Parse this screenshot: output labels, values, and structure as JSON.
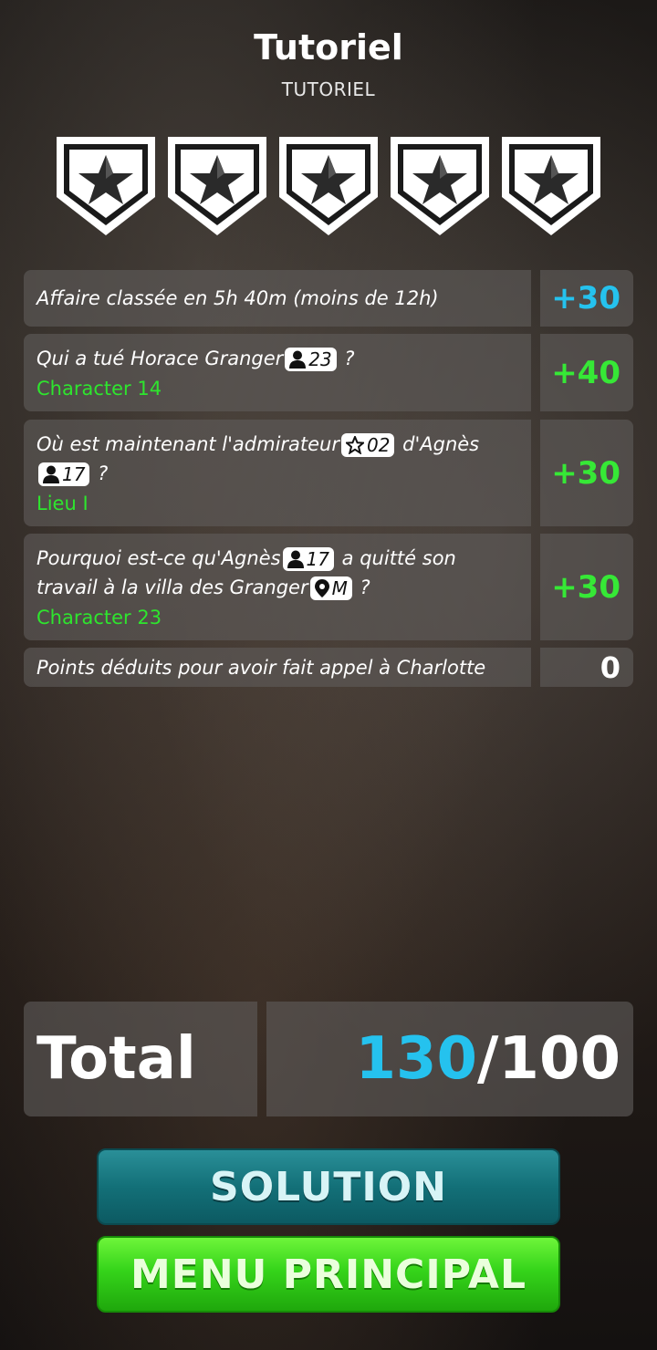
{
  "header": {
    "title": "Tutoriel",
    "subtitle": "TUTORIEL"
  },
  "stars": {
    "count": 5,
    "icon": "star-shield-icon"
  },
  "rows": [
    {
      "question": "Affaire classée en 5h 40m (moins de 12h)",
      "points": "+30",
      "points_color": "#25c2ee"
    },
    {
      "q_pre": "Qui a tué Horace Granger",
      "tag1": "23",
      "q_post": " ?",
      "answer": "Character 14",
      "points": "+40"
    },
    {
      "q_pre": "Où est maintenant l'admirateur",
      "tag1": "02",
      "q_mid": " d'Agnès",
      "tag2": "17",
      "q_post": " ?",
      "answer": "Lieu I",
      "points": "+30"
    },
    {
      "q_pre": "Pourquoi est-ce qu'Agnès",
      "tag1": "17",
      "q_mid": " a quitté son travail à la villa des Granger",
      "tag2": "M",
      "q_post": " ?",
      "answer": "Character 23",
      "points": "+30"
    },
    {
      "question": "Points déduits pour avoir fait appel à Charlotte",
      "points": "0"
    }
  ],
  "total": {
    "label": "Total",
    "score": "130",
    "max": "/100"
  },
  "buttons": {
    "solution": "SOLUTION",
    "menu": "MENU PRINCIPAL"
  },
  "colors": {
    "blue": "#25c2ee",
    "green": "#36e836"
  }
}
